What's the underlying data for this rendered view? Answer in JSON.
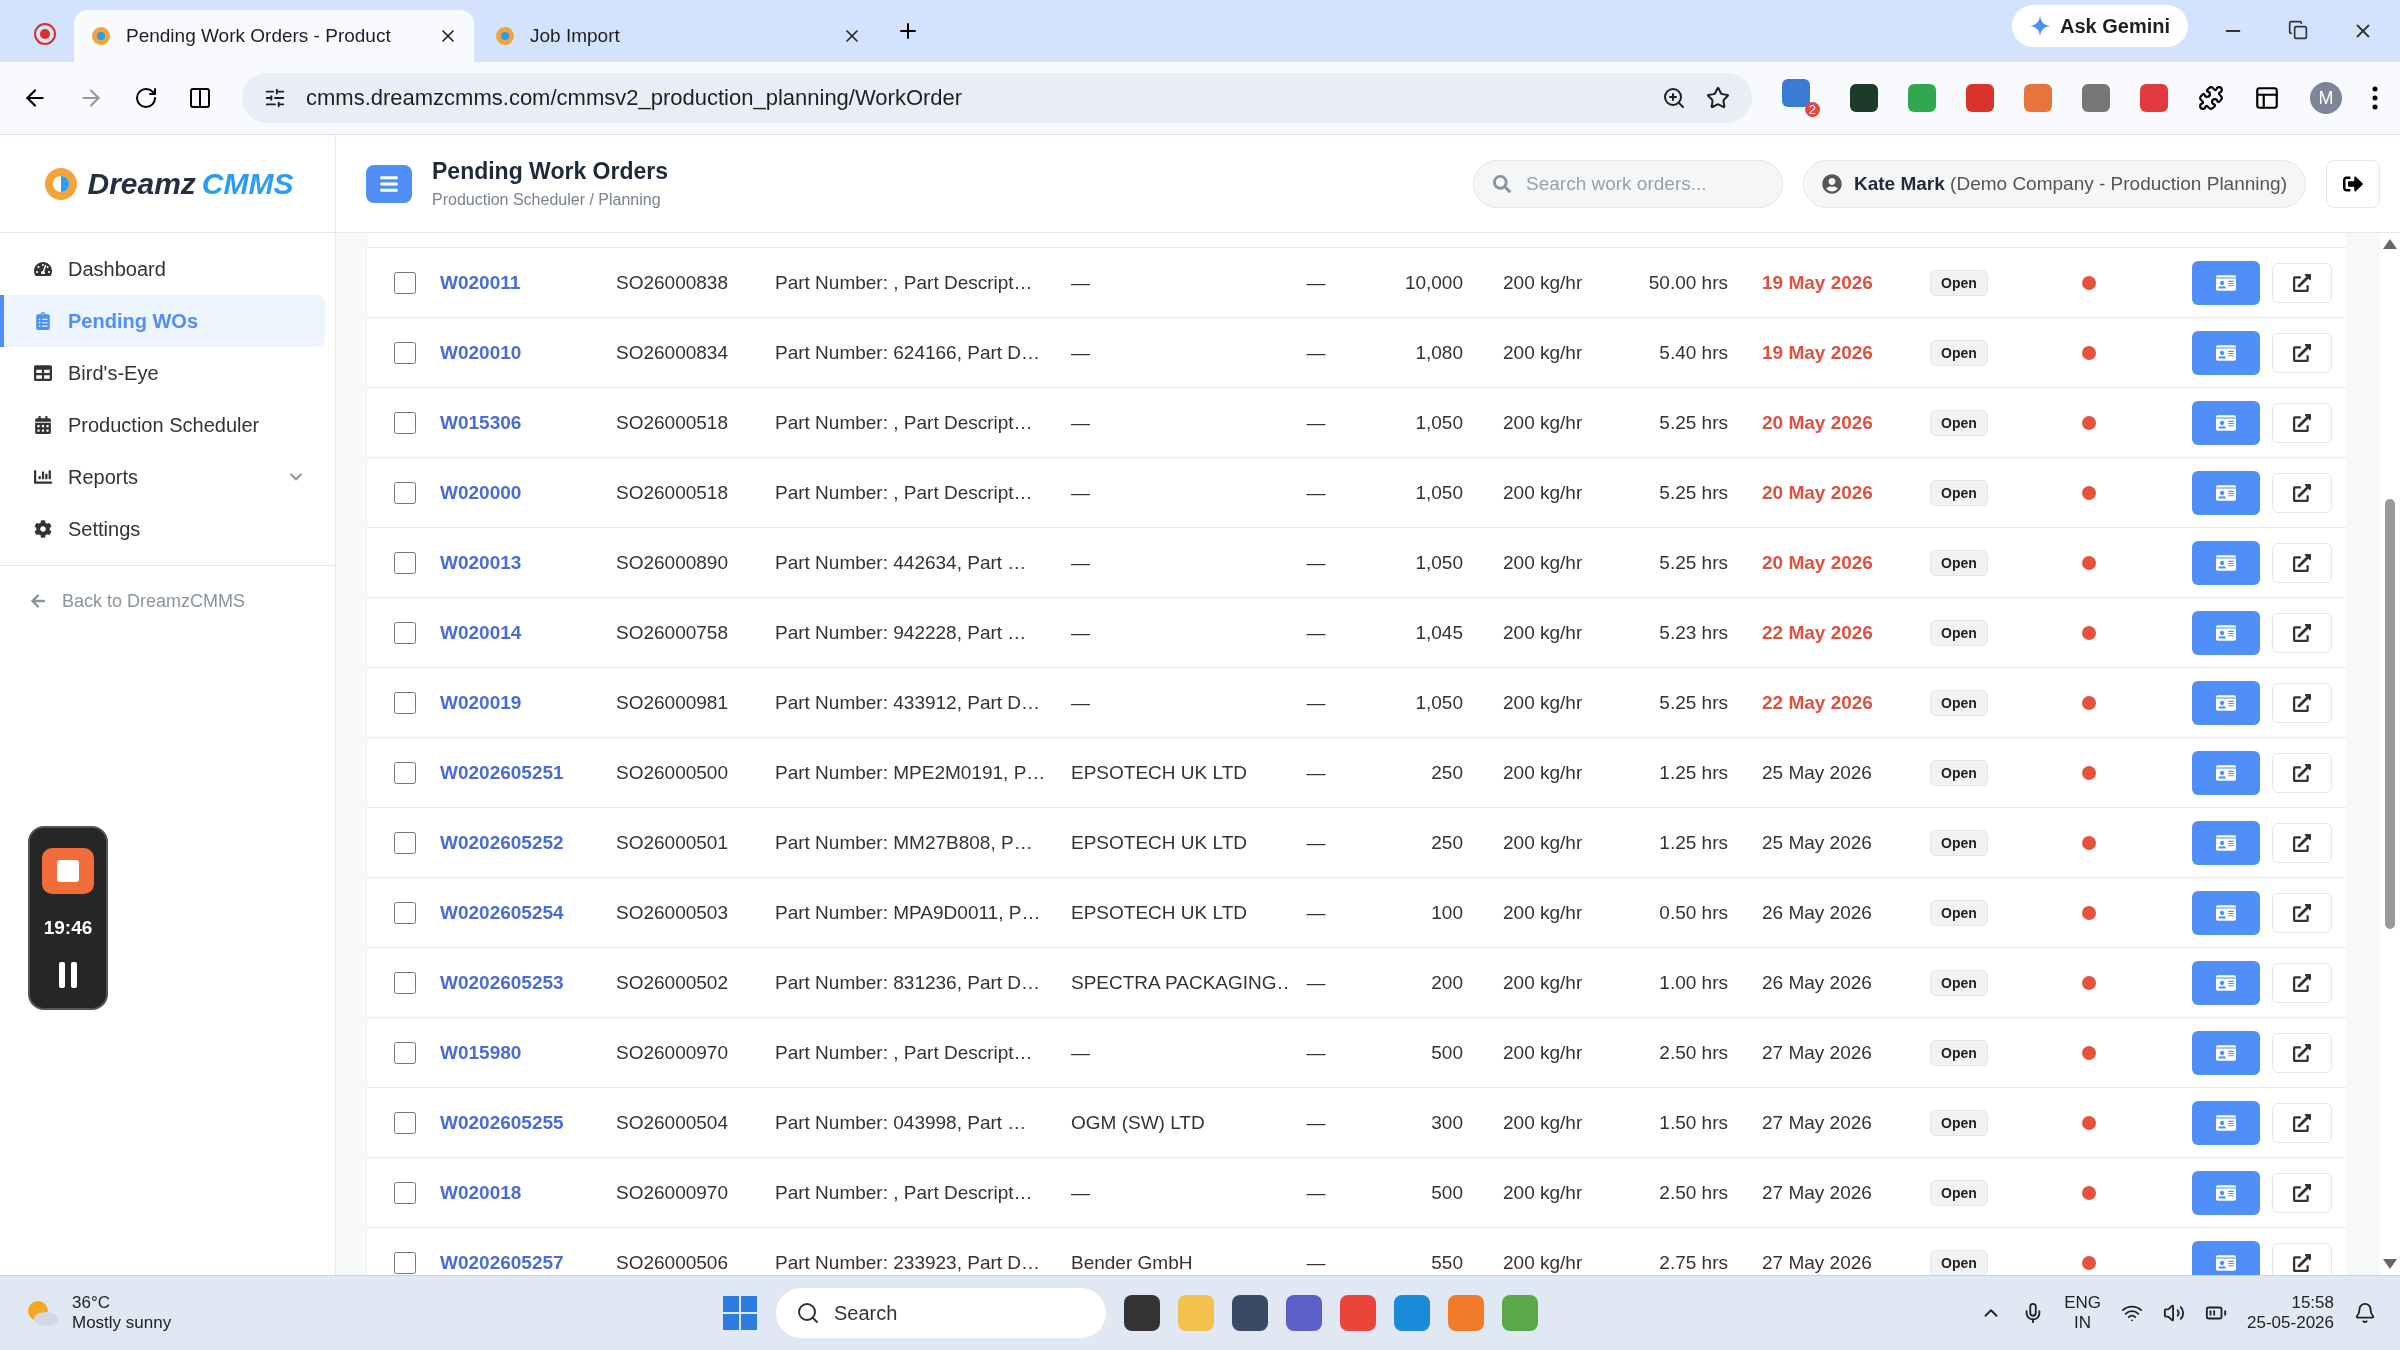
{
  "browser": {
    "tabs": [
      {
        "title": "Pending Work Orders - Product",
        "selected": true
      },
      {
        "title": "Job Import",
        "selected": false
      }
    ],
    "url": "cmms.dreamzcmms.com/cmmsv2_production_planning/WorkOrder",
    "gemini": "Ask Gemini",
    "extension_badge": "2",
    "profile": "M"
  },
  "sidebar": {
    "logo": {
      "word": "Dreamz",
      "accent": "CMMS"
    },
    "items": [
      {
        "label": "Dashboard",
        "selected": false,
        "expandable": false
      },
      {
        "label": "Pending WOs",
        "selected": true,
        "expandable": false
      },
      {
        "label": "Bird's-Eye",
        "selected": false,
        "expandable": false
      },
      {
        "label": "Production Scheduler",
        "selected": false,
        "expandable": false
      },
      {
        "label": "Reports",
        "selected": false,
        "expandable": true
      },
      {
        "label": "Settings",
        "selected": false,
        "expandable": false
      }
    ],
    "back": "Back to DreamzCMMS"
  },
  "header": {
    "title": "Pending Work Orders",
    "breadcrumb": "Production Scheduler / Planning",
    "search": {
      "placeholder": "Search work orders..."
    },
    "user": {
      "name": "Kate Mark",
      "company": "(Demo Company - Production Planning)"
    }
  },
  "table": {
    "rows": [
      {
        "checked": false,
        "wo": "W020011",
        "so": "SO26000838",
        "part": "Part Number: , Part Descript…",
        "customer": "—",
        "column_6": "—",
        "qty": "10,000",
        "rate": "200 kg/hr",
        "hours": "50.00 hrs",
        "date": "19 May 2026",
        "overdue": true,
        "status": "Open"
      },
      {
        "checked": false,
        "wo": "W020010",
        "so": "SO26000834",
        "part": "Part Number: 624166, Part D…",
        "customer": "—",
        "column_6": "—",
        "qty": "1,080",
        "rate": "200 kg/hr",
        "hours": "5.40 hrs",
        "date": "19 May 2026",
        "overdue": true,
        "status": "Open"
      },
      {
        "checked": false,
        "wo": "W015306",
        "so": "SO26000518",
        "part": "Part Number: , Part Descript…",
        "customer": "—",
        "column_6": "—",
        "qty": "1,050",
        "rate": "200 kg/hr",
        "hours": "5.25 hrs",
        "date": "20 May 2026",
        "overdue": true,
        "status": "Open"
      },
      {
        "checked": false,
        "wo": "W020000",
        "so": "SO26000518",
        "part": "Part Number: , Part Descript…",
        "customer": "—",
        "column_6": "—",
        "qty": "1,050",
        "rate": "200 kg/hr",
        "hours": "5.25 hrs",
        "date": "20 May 2026",
        "overdue": true,
        "status": "Open"
      },
      {
        "checked": false,
        "wo": "W020013",
        "so": "SO26000890",
        "part": "Part Number: 442634, Part …",
        "customer": "—",
        "column_6": "—",
        "qty": "1,050",
        "rate": "200 kg/hr",
        "hours": "5.25 hrs",
        "date": "20 May 2026",
        "overdue": true,
        "status": "Open"
      },
      {
        "checked": false,
        "wo": "W020014",
        "so": "SO26000758",
        "part": "Part Number: 942228, Part …",
        "customer": "—",
        "column_6": "—",
        "qty": "1,045",
        "rate": "200 kg/hr",
        "hours": "5.23 hrs",
        "date": "22 May 2026",
        "overdue": true,
        "status": "Open"
      },
      {
        "checked": false,
        "wo": "W020019",
        "so": "SO26000981",
        "part": "Part Number: 433912, Part D…",
        "customer": "—",
        "column_6": "—",
        "qty": "1,050",
        "rate": "200 kg/hr",
        "hours": "5.25 hrs",
        "date": "22 May 2026",
        "overdue": true,
        "status": "Open"
      },
      {
        "checked": false,
        "wo": "W0202605251",
        "so": "SO26000500",
        "part": "Part Number: MPE2M0191, P…",
        "customer": "EPSOTECH UK LTD",
        "column_6": "—",
        "qty": "250",
        "rate": "200 kg/hr",
        "hours": "1.25 hrs",
        "date": "25 May 2026",
        "overdue": false,
        "status": "Open"
      },
      {
        "checked": false,
        "wo": "W0202605252",
        "so": "SO26000501",
        "part": "Part Number: MM27B808, P…",
        "customer": "EPSOTECH UK LTD",
        "column_6": "—",
        "qty": "250",
        "rate": "200 kg/hr",
        "hours": "1.25 hrs",
        "date": "25 May 2026",
        "overdue": false,
        "status": "Open"
      },
      {
        "checked": false,
        "wo": "W0202605254",
        "so": "SO26000503",
        "part": "Part Number: MPA9D0011, P…",
        "customer": "EPSOTECH UK LTD",
        "column_6": "—",
        "qty": "100",
        "rate": "200 kg/hr",
        "hours": "0.50 hrs",
        "date": "26 May 2026",
        "overdue": false,
        "status": "Open"
      },
      {
        "checked": false,
        "wo": "W0202605253",
        "so": "SO26000502",
        "part": "Part Number: 831236, Part D…",
        "customer": "SPECTRA PACKAGING…",
        "column_6": "—",
        "qty": "200",
        "rate": "200 kg/hr",
        "hours": "1.00 hrs",
        "date": "26 May 2026",
        "overdue": false,
        "status": "Open"
      },
      {
        "checked": false,
        "wo": "W015980",
        "so": "SO26000970",
        "part": "Part Number: , Part Descript…",
        "customer": "—",
        "column_6": "—",
        "qty": "500",
        "rate": "200 kg/hr",
        "hours": "2.50 hrs",
        "date": "27 May 2026",
        "overdue": false,
        "status": "Open"
      },
      {
        "checked": false,
        "wo": "W0202605255",
        "so": "SO26000504",
        "part": "Part Number: 043998, Part …",
        "customer": "OGM (SW) LTD",
        "column_6": "—",
        "qty": "300",
        "rate": "200 kg/hr",
        "hours": "1.50 hrs",
        "date": "27 May 2026",
        "overdue": false,
        "status": "Open"
      },
      {
        "checked": false,
        "wo": "W020018",
        "so": "SO26000970",
        "part": "Part Number: , Part Descript…",
        "customer": "—",
        "column_6": "—",
        "qty": "500",
        "rate": "200 kg/hr",
        "hours": "2.50 hrs",
        "date": "27 May 2026",
        "overdue": false,
        "status": "Open"
      },
      {
        "checked": false,
        "wo": "W0202605257",
        "so": "SO26000506",
        "part": "Part Number: 233923, Part D…",
        "customer": "Bender GmbH",
        "column_6": "—",
        "qty": "550",
        "rate": "200 kg/hr",
        "hours": "2.75 hrs",
        "date": "27 May 2026",
        "overdue": false,
        "status": "Open"
      }
    ]
  },
  "recorder": {
    "time": "19:46"
  },
  "taskbar": {
    "weather": {
      "temp": "36°C",
      "condition": "Mostly sunny"
    },
    "search": "Search",
    "language": "ENG",
    "region": "IN",
    "time": "15:58",
    "date": "25-05-2026"
  }
}
